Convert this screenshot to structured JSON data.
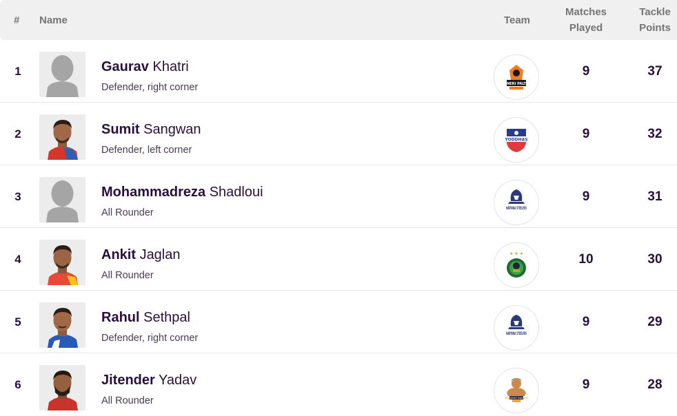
{
  "header": {
    "rank": "#",
    "name": "Name",
    "team": "Team",
    "matches_line1": "Matches",
    "matches_line2": "Played",
    "tackle_line1": "Tackle",
    "tackle_line2": "Points"
  },
  "rows": [
    {
      "rank": "1",
      "first": "Gaurav",
      "last": "Khatri",
      "role": "Defender, right corner",
      "team_logo": "puneri-paltan-logo",
      "logo_text": "PUNERI PALTAN",
      "matches": "9",
      "tackle_points": "37"
    },
    {
      "rank": "2",
      "first": "Sumit",
      "last": "Sangwan",
      "role": "Defender, left corner",
      "team_logo": "up-yoddhas-logo",
      "logo_text": "YODDHAS",
      "matches": "9",
      "tackle_points": "32"
    },
    {
      "rank": "3",
      "first": "Mohammadreza",
      "last": "Shadloui",
      "role": "All Rounder",
      "team_logo": "haryana-steelers-logo",
      "logo_text": "HARYANA STEELERS",
      "matches": "9",
      "tackle_points": "31"
    },
    {
      "rank": "4",
      "first": "Ankit",
      "last": "Jaglan",
      "role": "All Rounder",
      "team_logo": "patna-pirates-logo",
      "logo_text": "",
      "matches": "10",
      "tackle_points": "30"
    },
    {
      "rank": "5",
      "first": "Rahul",
      "last": "Sethpal",
      "role": "Defender, right corner",
      "team_logo": "haryana-steelers-logo",
      "logo_text": "HARYANA STEELERS",
      "matches": "9",
      "tackle_points": "29"
    },
    {
      "rank": "6",
      "first": "Jitender",
      "last": "Yadav",
      "role": "All Rounder",
      "team_logo": "gujarat-giants-logo",
      "logo_text": "GUJARAT GIANTS",
      "matches": "9",
      "tackle_points": "28"
    }
  ]
}
